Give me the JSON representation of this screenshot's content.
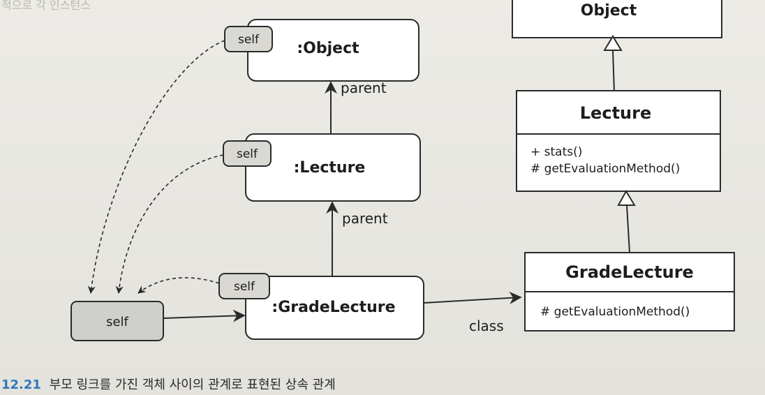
{
  "header_fragment": "적으로 각 인스턴스",
  "objects": {
    "object": {
      "label": ":Object",
      "self": "self"
    },
    "lecture": {
      "label": ":Lecture",
      "self": "self"
    },
    "grade_lecture": {
      "label": ":GradeLecture",
      "self": "self"
    },
    "self_ref": {
      "label": "self"
    }
  },
  "links": {
    "parent_upper": "parent",
    "parent_lower": "parent",
    "class": "class"
  },
  "classes": {
    "object": {
      "name": "Object"
    },
    "lecture": {
      "name": "Lecture",
      "methods": [
        "+ stats()",
        "# getEvaluationMethod()"
      ]
    },
    "grade_lecture": {
      "name": "GradeLecture",
      "methods": [
        "# getEvaluationMethod()"
      ]
    }
  },
  "caption": {
    "number": "12.21",
    "text": "부모 링크를 가진 객체 사이의 관계로 표현된 상속 관계"
  },
  "colors": {
    "box_fill": "#ffffff",
    "tab_fill": "#d9d8d3",
    "self_ref_fill": "#cfcfcb",
    "stroke": "#2a2a2a",
    "caption_number": "#2f78b8"
  }
}
